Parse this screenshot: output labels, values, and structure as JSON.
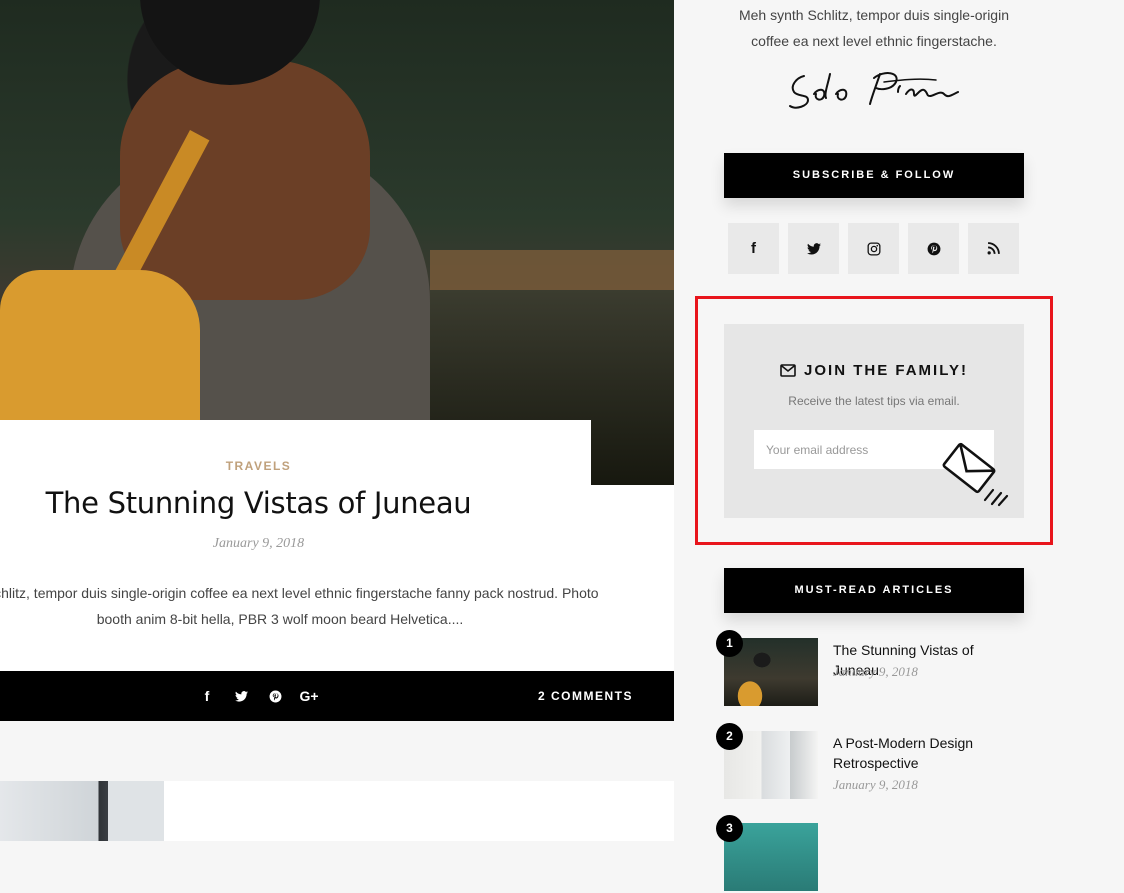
{
  "post": {
    "category": "TRAVELS",
    "title": "The Stunning Vistas of Juneau",
    "date": "January 9, 2018",
    "excerpt": "nth Schlitz, tempor duis single-origin coffee ea next level ethnic fingerstache fanny pack nostrud. Photo booth anim 8-bit hella, PBR 3 wolf moon beard Helvetica....",
    "share_icons": [
      "facebook-icon",
      "twitter-icon",
      "pinterest-icon",
      "google-plus-icon"
    ],
    "share_glyphs": [
      "f",
      "🐦",
      "℗",
      "G+"
    ],
    "comments_label": "2 COMMENTS"
  },
  "sidebar": {
    "about_text": "Meh synth Schlitz, tempor duis single-origin coffee ea next level ethnic fingerstache.",
    "signature": "Solo Pine",
    "subscribe_heading": "SUBSCRIBE & FOLLOW",
    "social": [
      {
        "icon": "facebook-icon",
        "glyph": "f"
      },
      {
        "icon": "twitter-icon",
        "glyph": "🐦"
      },
      {
        "icon": "instagram-icon",
        "glyph": "◎"
      },
      {
        "icon": "pinterest-icon",
        "glyph": "℗"
      },
      {
        "icon": "rss-icon",
        "glyph": "≋"
      }
    ],
    "newsletter": {
      "title": "JOIN THE FAMILY!",
      "subtitle": "Receive the latest tips via email.",
      "placeholder": "Your email address",
      "value": ""
    },
    "must_read_heading": "MUST-READ ARTICLES",
    "articles": [
      {
        "num": "1",
        "title": "The Stunning Vistas of Juneau",
        "date": "January 9, 2018"
      },
      {
        "num": "2",
        "title": "A Post-Modern Design Retrospective",
        "date": "January 9, 2018"
      },
      {
        "num": "3",
        "title": "",
        "date": ""
      }
    ]
  },
  "colors": {
    "accent": "#c0a17c",
    "highlight_border": "#e8141b",
    "heading_bg": "#000000",
    "page_bg": "#f6f6f6"
  }
}
